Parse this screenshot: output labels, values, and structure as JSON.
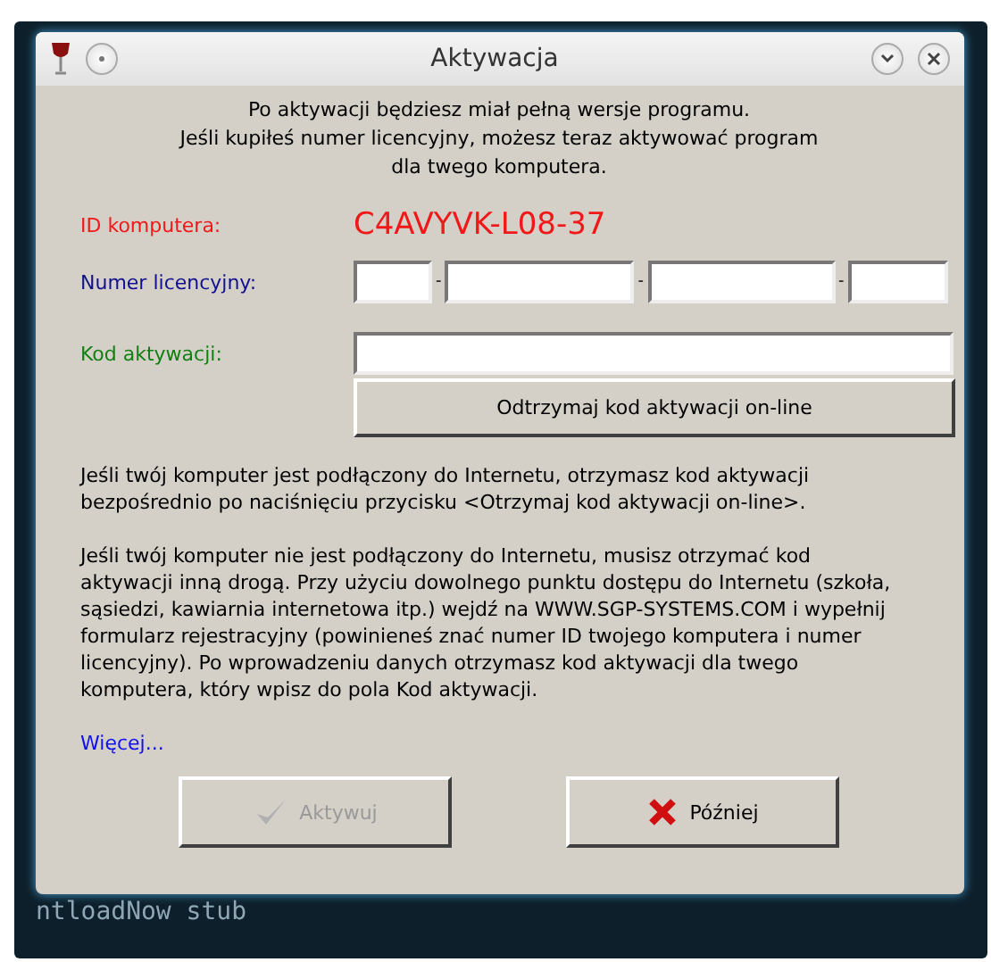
{
  "window": {
    "title": "Aktywacja"
  },
  "intro": [
    "Po aktywacji będziesz miał pełną wersje programu.",
    "Jeśli kupiłeś numer licencyjny, możesz teraz aktywować program",
    "dla twego komputera."
  ],
  "computer_id": {
    "label": "ID komputera:",
    "value": "C4AVYVK-L08-37"
  },
  "license": {
    "label": "Numer licencyjny:",
    "separators": [
      "-",
      "-",
      "-"
    ]
  },
  "activation_code": {
    "label": "Kod aktywacji:"
  },
  "online_button": {
    "label": "Odtrzymaj kod aktywacji on-line"
  },
  "paragraphs": [
    "Jeśli twój komputer jest podłączony do Internetu, otrzymasz kod aktywacji bezpośrednio po naciśnięciu przycisku <Otrzymaj kod aktywacji on-line>.",
    "Jeśli twój komputer nie jest podłączony do Internetu, musisz otrzymać kod aktywacji inną drogą. Przy użyciu dowolnego punktu dostępu do Internetu (szkoła, sąsiedzi, kawiarnia internetowa itp.) wejdź na WWW.SGP-SYSTEMS.COM i wypełnij formularz rejestracyjny (powinieneś znać numer ID twojego komputera i numer licencyjny). Po wprowadzeniu danych otrzymasz kod aktywacji dla twego komputera, który wpisz do pola Kod aktywacji."
  ],
  "more_link": "Więcej...",
  "buttons": [
    {
      "kind": "activate",
      "label": "Aktywuj",
      "disabled": true
    },
    {
      "kind": "later",
      "label": "Później",
      "disabled": false
    }
  ],
  "terminal_line": "ntloadNow stub"
}
